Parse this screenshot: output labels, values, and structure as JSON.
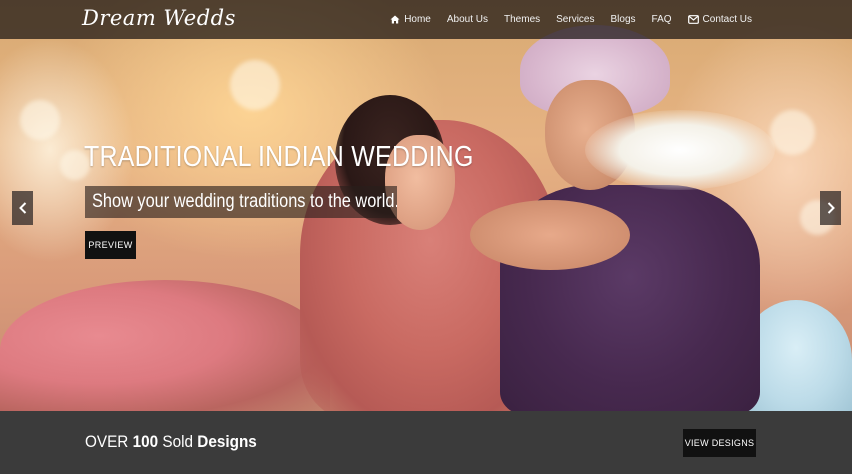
{
  "brand": {
    "name": "Dream Wedds"
  },
  "nav": {
    "items": [
      {
        "label": "Home",
        "icon": "home-icon"
      },
      {
        "label": "About Us"
      },
      {
        "label": "Themes"
      },
      {
        "label": "Services"
      },
      {
        "label": "Blogs"
      },
      {
        "label": "FAQ"
      },
      {
        "label": "Contact Us",
        "icon": "envelope-icon"
      }
    ]
  },
  "slide": {
    "title": "TRADITIONAL INDIAN WEDDING",
    "subtitle": "Show your wedding traditions to the world.",
    "button_label": "PREVIEW"
  },
  "carousel": {
    "prev_icon": "chevron-left-icon",
    "next_icon": "chevron-right-icon"
  },
  "cta": {
    "prefix": "OVER ",
    "count": "100",
    "middle": " Sold ",
    "emphasis": "Designs",
    "button_label": "VIEW DESIGNS"
  },
  "colors": {
    "navbar_bg": "#191412",
    "cta_bar_bg": "#3b3b3b",
    "button_bg": "#111111",
    "text": "#ffffff"
  }
}
